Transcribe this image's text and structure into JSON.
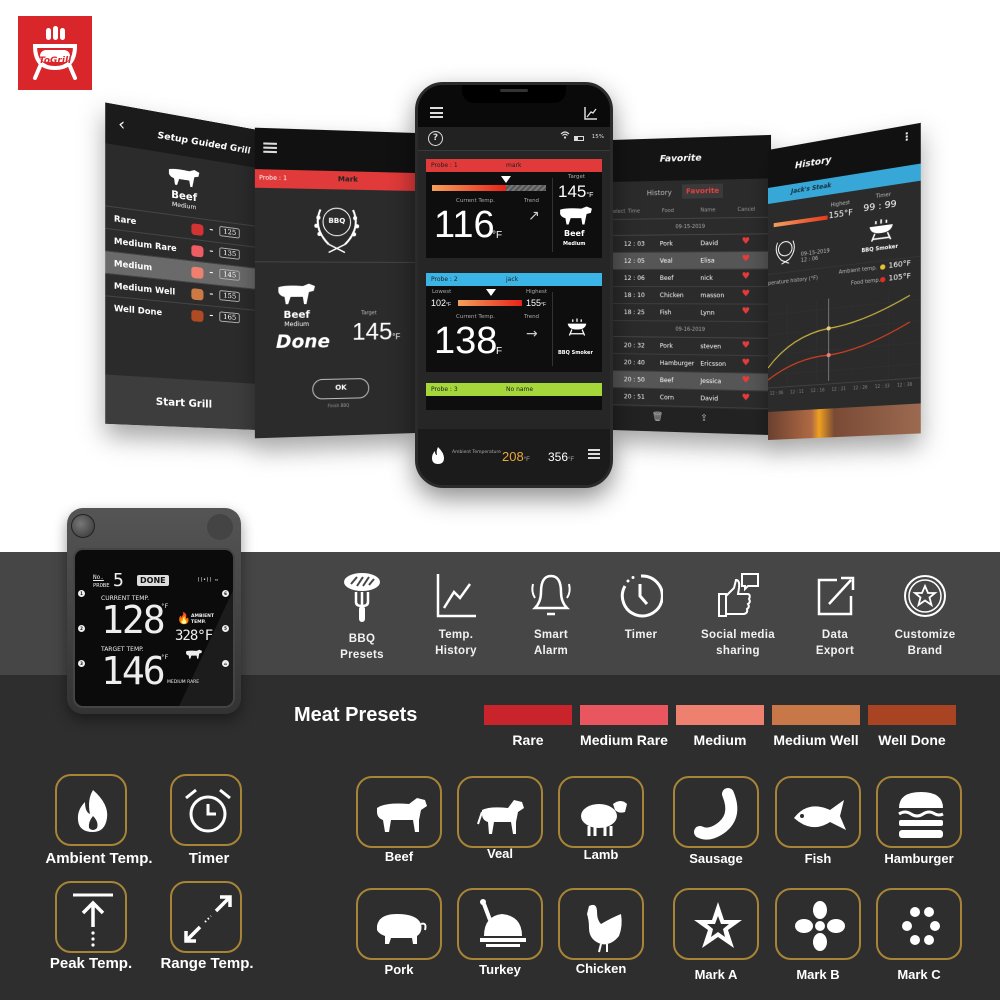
{
  "brand": {
    "name": "ToGrill",
    "color": "#d9262a"
  },
  "screens": {
    "setup": {
      "title": "Setup Guided Grill",
      "back_icon": "chevron-left-icon",
      "meat": "Beef",
      "doneness": "Medium",
      "rows": [
        {
          "label": "Rare",
          "value": "125",
          "color": "#d23333"
        },
        {
          "label": "Medium Rare",
          "value": "135",
          "color": "#ee5d63"
        },
        {
          "label": "Medium",
          "value": "145",
          "color": "#ee8070"
        },
        {
          "label": "Medium Well",
          "value": "155",
          "color": "#cc7a45"
        },
        {
          "label": "Well Done",
          "value": "165",
          "color": "#b04a22"
        }
      ],
      "start_button": "Start Grill"
    },
    "done": {
      "probe": "Probe : 1",
      "name": "Mark",
      "badge": "BBQ",
      "meat": "Beef",
      "doneness": "Medium",
      "status": "Done",
      "target_label": "Target",
      "target": "145",
      "unit": "°F",
      "ok_button": "OK",
      "finish_text": "Finish BBQ"
    },
    "favorite": {
      "title": "Favorite",
      "tabs": [
        "History",
        "Favorite"
      ],
      "active_tab": "Favorite",
      "columns": [
        "Select",
        "Time",
        "Food",
        "Name",
        "Cancel"
      ],
      "groups": [
        {
          "date": "09-15-2019",
          "rows": [
            {
              "time": "12 : 03",
              "food": "Pork",
              "name": "David"
            },
            {
              "time": "12 : 05",
              "food": "Veal",
              "name": "Elisa",
              "selected": true
            },
            {
              "time": "12 : 06",
              "food": "Beef",
              "name": "nick"
            },
            {
              "time": "18 : 10",
              "food": "Chicken",
              "name": "masson"
            },
            {
              "time": "18 : 25",
              "food": "Fish",
              "name": "Lynn"
            }
          ]
        },
        {
          "date": "09-16-2019",
          "rows": [
            {
              "time": "20 : 32",
              "food": "Pork",
              "name": "steven"
            },
            {
              "time": "20 : 40",
              "food": "Hamburger",
              "name": "Ericsson"
            },
            {
              "time": "20 : 50",
              "food": "Beef",
              "name": "Jessica",
              "selected": true
            },
            {
              "time": "20 : 51",
              "food": "Corn",
              "name": "David"
            }
          ]
        }
      ],
      "footer_icons": [
        "trash-icon",
        "share-icon"
      ]
    },
    "history": {
      "title": "History",
      "session": "Jack's Steak",
      "highest_label": "Highest",
      "highest": "155°F",
      "timer_label": "Timer",
      "timer": "99 : 99",
      "date": "09-15-2019",
      "time": "12 : 06",
      "device": "BBQ Smoker",
      "chart_title": "Temperature history (°F)",
      "legend": [
        {
          "label": "Ambient temp.",
          "value": "160°F",
          "color": "#e8c030"
        },
        {
          "label": "Food temp.",
          "value": "105°F",
          "color": "#e03020"
        }
      ],
      "x_ticks": [
        "12 : 06",
        "12 : 11",
        "12 : 16",
        "12 : 21",
        "12 : 26",
        "12 : 33",
        "12 : 38"
      ],
      "x_unit": "time"
    }
  },
  "phone": {
    "battery": "15%",
    "probes": [
      {
        "label": "Probe : 1",
        "name": "mark",
        "color": "#e03a3a",
        "gauge_fraction": 0.65,
        "current_label": "Current Temp.",
        "current": "116",
        "unit": "°F",
        "trend_label": "Trend",
        "trend": "↗",
        "target_label": "Target",
        "target": "145",
        "meat": "Beef",
        "doneness": "Medium"
      },
      {
        "label": "Probe : 2",
        "name": "jack",
        "color": "#3ab5e6",
        "lowest_label": "Lowest",
        "lowest": "102",
        "highest_label": "Highest",
        "highest": "155",
        "current_label": "Current Temp.",
        "current": "138",
        "unit": "°F",
        "trend_label": "Trend",
        "trend": "→",
        "device": "BBQ Smoker"
      },
      {
        "label": "Probe : 3",
        "name": "No name",
        "color": "#a5d63a"
      }
    ],
    "ambient_label": "Ambient Temperature",
    "ambient_current": "208",
    "ambient_target": "356",
    "unit": "°F"
  },
  "device": {
    "no_label": "No.",
    "probe_label": "PROBE",
    "probe_number": "5",
    "status": "DONE",
    "current_label": "CURRENT TEMP.",
    "current": "128",
    "target_label": "TARGET TEMP.",
    "target": "146",
    "ambient_label": "AMBIENT TEMP.",
    "ambient": "328°F",
    "unit": "°F",
    "doneness": "MEDIUM RARE",
    "side_buttons_left": [
      "1",
      "2",
      "3"
    ],
    "side_buttons_right": [
      "6",
      "5",
      "⌂"
    ]
  },
  "features": [
    {
      "icon": "bbq-presets-icon",
      "label": "BBQ\nPresets"
    },
    {
      "icon": "temp-history-icon",
      "label": "Temp.\nHistory"
    },
    {
      "icon": "smart-alarm-icon",
      "label": "Smart\nAlarm"
    },
    {
      "icon": "timer-icon",
      "label": "Timer"
    },
    {
      "icon": "social-share-icon",
      "label": "Social media\nsharing"
    },
    {
      "icon": "data-export-icon",
      "label": "Data\nExport"
    },
    {
      "icon": "customize-brand-icon",
      "label": "Customize\nBrand"
    }
  ],
  "meat_presets": {
    "title": "Meat Presets",
    "levels": [
      {
        "label": "Rare",
        "color": "#c9242c"
      },
      {
        "label": "Medium Rare",
        "color": "#e95660"
      },
      {
        "label": "Medium",
        "color": "#ee8070"
      },
      {
        "label": "Medium Well",
        "color": "#c87848"
      },
      {
        "label": "Well Done",
        "color": "#a84422"
      }
    ]
  },
  "modes": [
    {
      "icon": "flame-icon",
      "label": "Ambient Temp."
    },
    {
      "icon": "alarm-clock-icon",
      "label": "Timer"
    },
    {
      "icon": "peak-arrow-icon",
      "label": "Peak Temp."
    },
    {
      "icon": "range-arrows-icon",
      "label": "Range Temp."
    }
  ],
  "meats": [
    {
      "icon": "cow-icon",
      "label": "Beef"
    },
    {
      "icon": "calf-icon",
      "label": "Veal"
    },
    {
      "icon": "sheep-icon",
      "label": "Lamb"
    },
    {
      "icon": "sausage-icon",
      "label": "Sausage"
    },
    {
      "icon": "fish-icon",
      "label": "Fish"
    },
    {
      "icon": "hamburger-icon",
      "label": "Hamburger"
    },
    {
      "icon": "pig-icon",
      "label": "Pork"
    },
    {
      "icon": "turkey-icon",
      "label": "Turkey"
    },
    {
      "icon": "chicken-icon",
      "label": "Chicken"
    },
    {
      "icon": "star-icon",
      "label": "Mark A"
    },
    {
      "icon": "flower-icon",
      "label": "Mark B"
    },
    {
      "icon": "dots-icon",
      "label": "Mark C"
    }
  ],
  "accent": {
    "tile_border": "#a88436",
    "ambient_temp": "#e8a93a"
  }
}
